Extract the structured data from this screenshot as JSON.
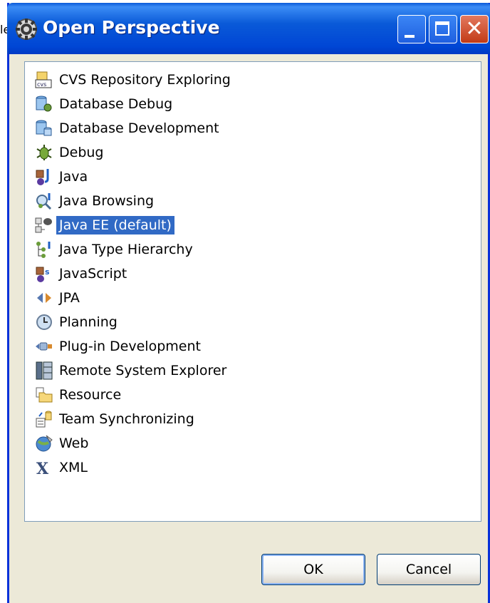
{
  "background_fragment": "le",
  "window": {
    "title": "Open Perspective",
    "controls": [
      "minimize",
      "maximize",
      "close"
    ]
  },
  "perspectives": [
    {
      "label": "CVS Repository Exploring",
      "icon": "cvs-repository-icon",
      "selected": false
    },
    {
      "label": "Database Debug",
      "icon": "database-debug-icon",
      "selected": false
    },
    {
      "label": "Database Development",
      "icon": "database-development-icon",
      "selected": false
    },
    {
      "label": "Debug",
      "icon": "debug-bug-icon",
      "selected": false
    },
    {
      "label": "Java",
      "icon": "java-icon",
      "selected": false
    },
    {
      "label": "Java Browsing",
      "icon": "java-browsing-icon",
      "selected": false
    },
    {
      "label": "Java EE (default)",
      "icon": "java-ee-icon",
      "selected": true
    },
    {
      "label": "Java Type Hierarchy",
      "icon": "java-type-hierarchy-icon",
      "selected": false
    },
    {
      "label": "JavaScript",
      "icon": "javascript-icon",
      "selected": false
    },
    {
      "label": "JPA",
      "icon": "jpa-icon",
      "selected": false
    },
    {
      "label": "Planning",
      "icon": "planning-clock-icon",
      "selected": false
    },
    {
      "label": "Plug-in Development",
      "icon": "plugin-development-icon",
      "selected": false
    },
    {
      "label": "Remote System Explorer",
      "icon": "remote-system-explorer-icon",
      "selected": false
    },
    {
      "label": "Resource",
      "icon": "resource-folder-icon",
      "selected": false
    },
    {
      "label": "Team Synchronizing",
      "icon": "team-synchronizing-icon",
      "selected": false
    },
    {
      "label": "Web",
      "icon": "web-globe-icon",
      "selected": false
    },
    {
      "label": "XML",
      "icon": "xml-icon",
      "selected": false
    }
  ],
  "buttons": {
    "ok_label": "OK",
    "cancel_label": "Cancel"
  },
  "colors": {
    "selection": "#316ac5",
    "titlebar": "#0a5ad8",
    "dialog_bg": "#ece9d8"
  }
}
